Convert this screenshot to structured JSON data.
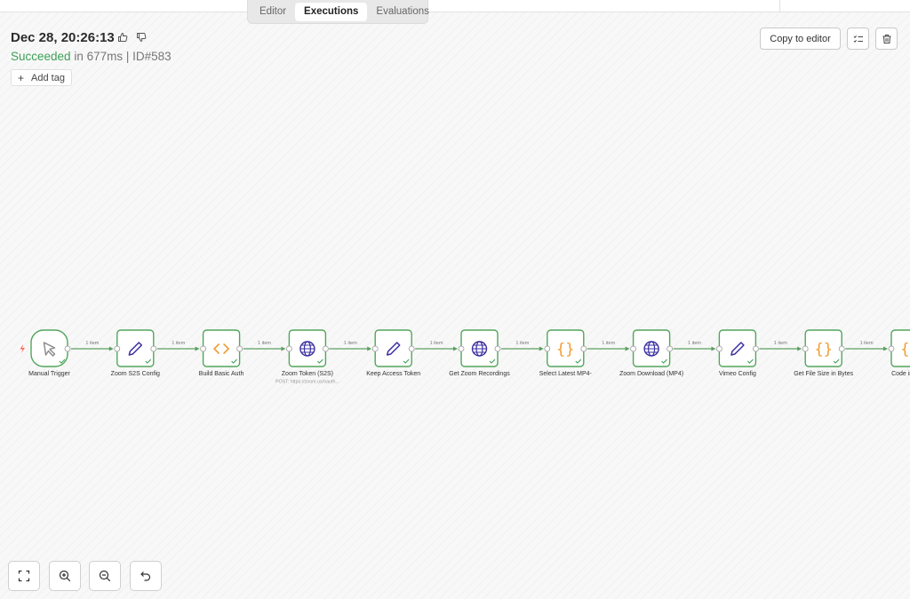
{
  "tabs": [
    {
      "label": "Editor",
      "active": false
    },
    {
      "label": "Executions",
      "active": true
    },
    {
      "label": "Evaluations",
      "active": false
    }
  ],
  "execution": {
    "date": "Dec 28, 20:26:13",
    "status": "Succeeded",
    "duration_text": " in 677ms | ID#583"
  },
  "add_tag_label": "Add tag",
  "copy_to_editor_label": "Copy to editor",
  "colors": {
    "success": "#3ca055",
    "node_border": "#52a65b",
    "connector": "#5aa05f",
    "http_icon": "#3b2fa0",
    "set_icon": "#3b2fa0",
    "code_icon": "#ef9c33",
    "trigger_icon": "#888888",
    "trigger_bolt": "#ff6b55"
  },
  "workflow": {
    "nodes": [
      {
        "label": "Manual Trigger",
        "icon": "cursor-icon",
        "kind": "trigger"
      },
      {
        "label": "Zoom S2S Config",
        "icon": "pencil-icon",
        "kind": "set"
      },
      {
        "label": "Build Basic Auth",
        "icon": "code-icon",
        "kind": "code-angle"
      },
      {
        "label": "Zoom Token (S2S)",
        "subtitle": "POST: https://zoom.us/oauth...",
        "icon": "globe-icon",
        "kind": "http"
      },
      {
        "label": "Keep Access Token",
        "icon": "pencil-icon",
        "kind": "set"
      },
      {
        "label": "Get Zoom Recordings",
        "icon": "globe-icon",
        "kind": "http"
      },
      {
        "label": "Select Latest MP4-",
        "icon": "braces-icon",
        "kind": "code-braces"
      },
      {
        "label": "Zoom Download (MP4)",
        "icon": "globe-icon",
        "kind": "http"
      },
      {
        "label": "Vimeo Config",
        "icon": "pencil-icon",
        "kind": "set"
      },
      {
        "label": "Get File Size in Bytes",
        "icon": "braces-icon",
        "kind": "code-braces"
      },
      {
        "label": "Code in Java",
        "icon": "braces-icon",
        "kind": "code-braces"
      }
    ],
    "connections": [
      {
        "label": "1 item"
      },
      {
        "label": "1 item"
      },
      {
        "label": "1 item"
      },
      {
        "label": "1 item"
      },
      {
        "label": "1 item"
      },
      {
        "label": "1 item"
      },
      {
        "label": "1 item"
      },
      {
        "label": "1 item"
      },
      {
        "label": "1 item"
      },
      {
        "label": "1 item"
      }
    ]
  },
  "controls": [
    {
      "name": "fit-view-button",
      "icon": "fit-view-icon"
    },
    {
      "name": "zoom-in-button",
      "icon": "zoom-in-icon"
    },
    {
      "name": "zoom-out-button",
      "icon": "zoom-out-icon"
    },
    {
      "name": "reset-zoom-button",
      "icon": "undo-icon"
    }
  ]
}
